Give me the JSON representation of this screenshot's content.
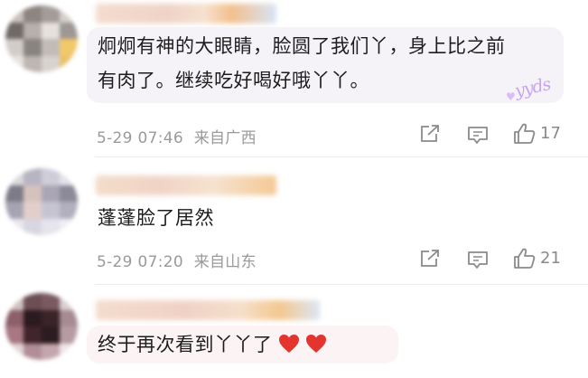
{
  "comments": [
    {
      "text_line1": "炯炯有神的大眼睛，脸圆了我们丫，身上比之前",
      "text_line2": "有肉了。继续吃好喝好哦丫丫。",
      "sticker": "yyds",
      "time": "5-29 07:46",
      "location": "来自广西",
      "likes": "17"
    },
    {
      "text_line1": "蓬蓬脸了居然",
      "time": "5-29 07:20",
      "location": "来自山东",
      "likes": "21"
    },
    {
      "text_line1": "终于再次看到丫丫了",
      "emoji": "red-heart ×2"
    }
  ],
  "icons": {
    "share": "share-icon",
    "comment": "comment-icon",
    "like": "thumbs-up-icon"
  },
  "colors": {
    "bubble": "#f6f3f8",
    "meta_text": "#9a9a9a",
    "heart": "#e3342f",
    "sticker": "#c9a3f0"
  }
}
